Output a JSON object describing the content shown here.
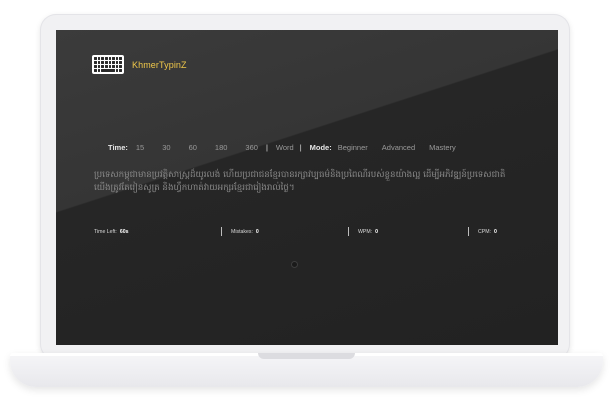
{
  "app": {
    "brand_name": "KhmerTypinZ",
    "logo_icon": "keyboard-icon"
  },
  "settings": {
    "time_label": "Time:",
    "time_options": [
      "15",
      "30",
      "60",
      "180",
      "360"
    ],
    "word_option": "Word",
    "separator": "|",
    "mode_label": "Mode:",
    "mode_options": [
      "Beginner",
      "Advanced",
      "Mastery"
    ]
  },
  "typing_text": "ប្រទេសកម្ពុជាមានប្រវត្តិសាស្ត្រដ៏យូរលង់ ហើយប្រជាជនខ្មែរបានរក្សាវប្បធម៌និងប្រពៃណីរបស់ខ្លួនយ៉ាងល្អ ដើម្បីអភិវឌ្ឍន៍ប្រទេសជាតិ យើងត្រូវតែរៀនសូត្រ និងហ្វឹកហាត់វាយអក្សរខ្មែរជារៀងរាល់ថ្ងៃ។",
  "stats": {
    "time_left_label": "Time Left:",
    "time_left_value": "60s",
    "mistakes_label": "Mistakes:",
    "mistakes_value": "0",
    "wpm_label": "WPM:",
    "wpm_value": "0",
    "cpm_label": "CPM:",
    "cpm_value": "0"
  },
  "colors": {
    "brand": "#f0c84a",
    "screen_bg": "#2a2a2a",
    "inactive_option": "#9a9a9a",
    "active_label": "#e6e6e6"
  }
}
